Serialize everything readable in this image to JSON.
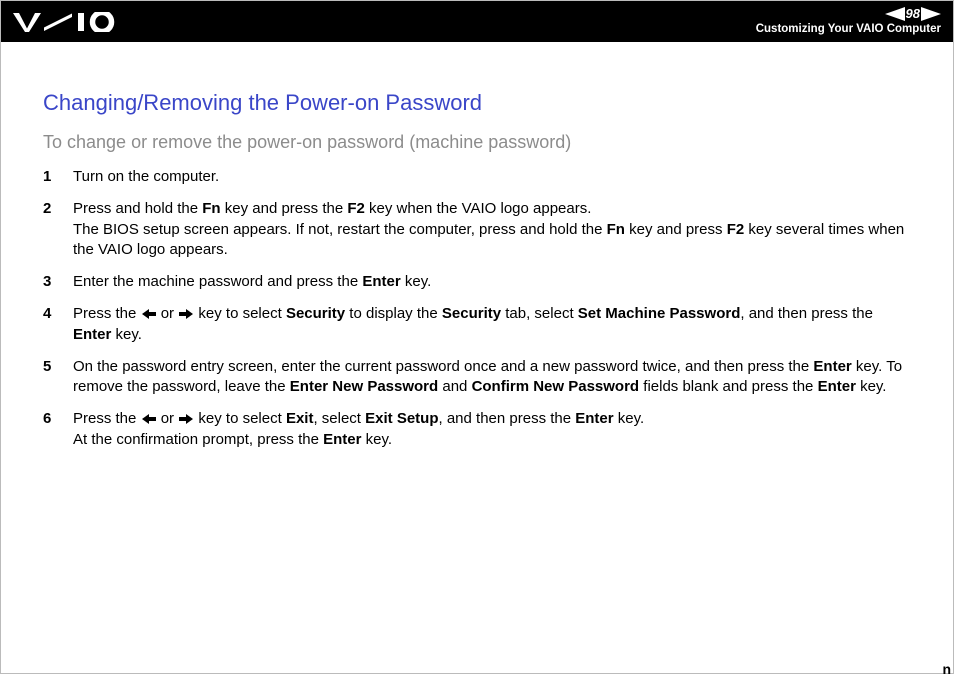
{
  "header": {
    "page_number": "98",
    "section_title": "Customizing Your VAIO Computer"
  },
  "main": {
    "title": "Changing/Removing the Power-on Password",
    "subtitle": "To change or remove the power-on password (machine password)",
    "steps": [
      {
        "n": "1",
        "html": "Turn on the computer."
      },
      {
        "n": "2",
        "html": "Press and hold the <b>Fn</b> key and press the <b>F2</b> key when the VAIO logo appears.<br>The BIOS setup screen appears. If not, restart the computer, press and hold the <b>Fn</b> key and press <b>F2</b> key several times when the VAIO logo appears."
      },
      {
        "n": "3",
        "html": "Enter the machine password and press the <b>Enter</b> key."
      },
      {
        "n": "4",
        "html": "Press the {LARR} or {RARR} key to select <b>Security</b> to display the <b>Security</b> tab, select <b>Set Machine Password</b>, and then press the <b>Enter</b> key."
      },
      {
        "n": "5",
        "html": "On the password entry screen, enter the current password once and a new password twice, and then press the <b>Enter</b> key. To remove the password, leave the <b>Enter New Password</b> and <b>Confirm New Password</b> fields blank and press the <b>Enter</b> key."
      },
      {
        "n": "6",
        "html": "Press the {LARR} or {RARR} key to select <b>Exit</b>, select <b>Exit Setup</b>, and then press the <b>Enter</b> key.<br>At the confirmation prompt, press the <b>Enter</b> key."
      }
    ]
  }
}
